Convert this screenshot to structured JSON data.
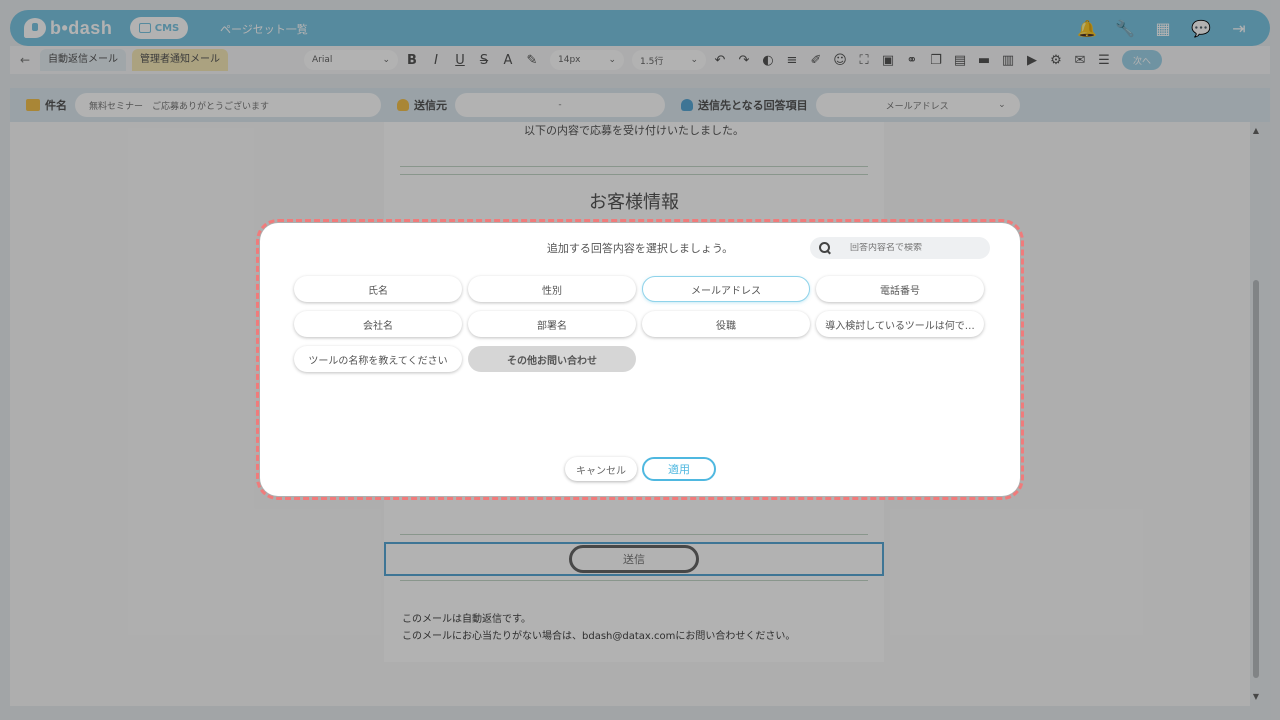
{
  "header": {
    "brand": "b•dash",
    "cms_label": "CMS",
    "page_title": "ページセット一覧",
    "icons": [
      "bell-icon",
      "wrench-icon",
      "grid-icon",
      "chat-icon",
      "logout-icon"
    ]
  },
  "toolbar": {
    "tabs": [
      {
        "label": "自動返信メール",
        "active": true
      },
      {
        "label": "管理者通知メール",
        "active": false
      }
    ],
    "font_family": "Arial",
    "font_size": "14px",
    "line_height": "1.5行",
    "next_label": "次へ"
  },
  "fields": {
    "subject_label": "件名",
    "subject_value": "無料セミナー　ご応募ありがとうございます",
    "sender_label": "送信元",
    "sender_value": "-",
    "recipient_label": "送信先となる回答項目",
    "recipient_value": "メールアドレス"
  },
  "email": {
    "intro": "以下の内容で応募を受け付けいたしました。",
    "heading": "お客様情報",
    "send_label": "送信",
    "footer_1": "このメールは自動返信です。",
    "footer_2": "このメールにお心当たりがない場合は、bdash@datax.comにお問い合わせください。"
  },
  "modal": {
    "title": "追加する回答内容を選択しましょう。",
    "search_placeholder": "回答内容名で検索",
    "items": [
      {
        "label": "氏名",
        "state": "normal"
      },
      {
        "label": "性別",
        "state": "normal"
      },
      {
        "label": "メールアドレス",
        "state": "selected"
      },
      {
        "label": "電話番号",
        "state": "normal"
      },
      {
        "label": "会社名",
        "state": "normal"
      },
      {
        "label": "部署名",
        "state": "normal"
      },
      {
        "label": "役職",
        "state": "normal"
      },
      {
        "label": "導入検討しているツールは何で…",
        "state": "normal"
      },
      {
        "label": "ツールの名称を教えてください",
        "state": "normal"
      },
      {
        "label": "その他お問い合わせ",
        "state": "disabled"
      }
    ],
    "cancel_label": "キャンセル",
    "apply_label": "適用"
  },
  "colors": {
    "brand": "#7cc6e3",
    "accent": "#4fb8e0",
    "highlight_ring": "#f07b7b"
  }
}
